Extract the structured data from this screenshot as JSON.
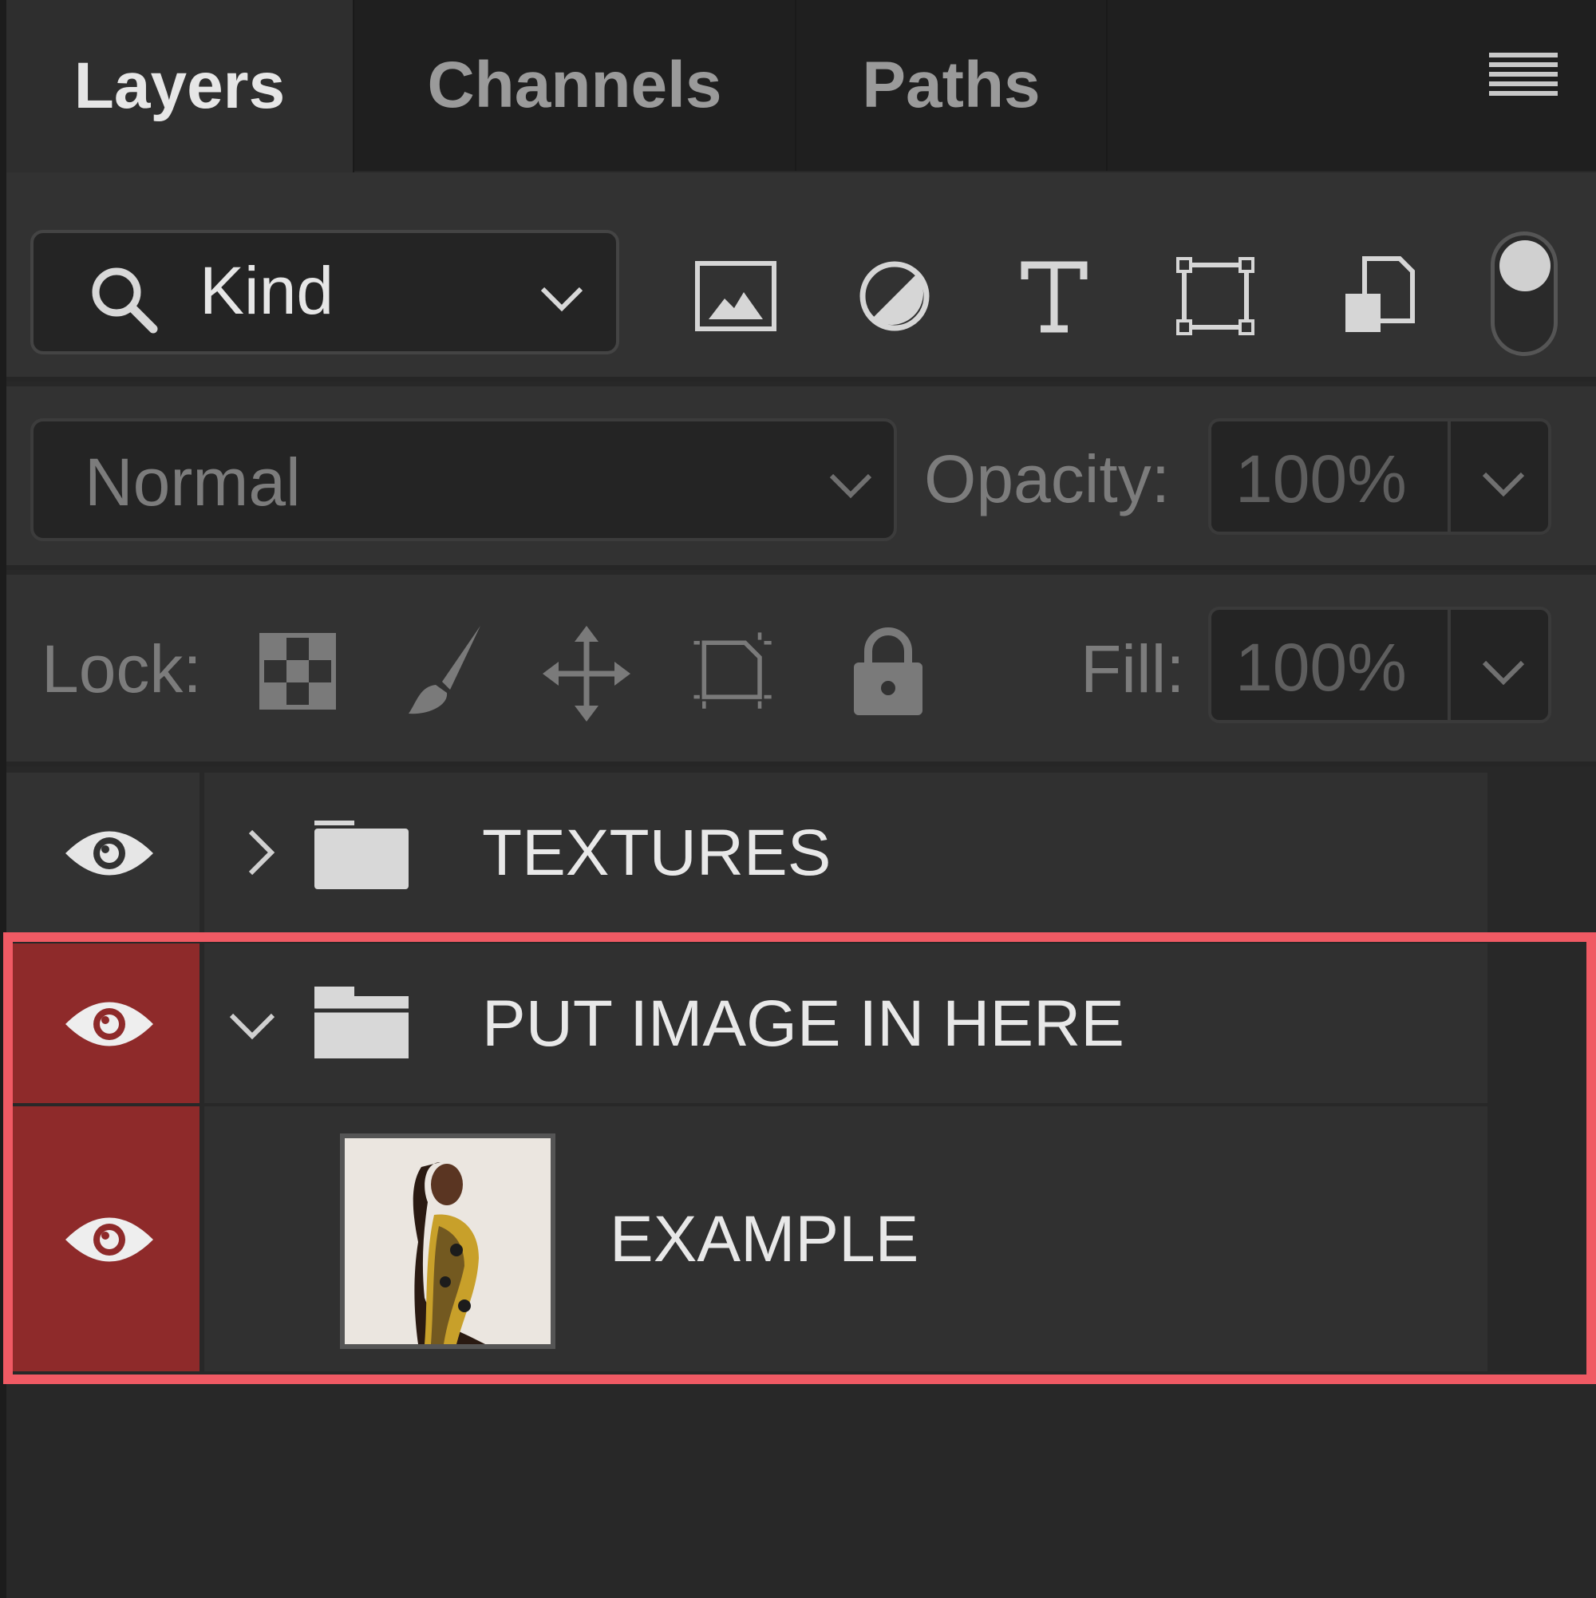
{
  "tabs": [
    {
      "label": "Layers",
      "active": true
    },
    {
      "label": "Channels",
      "active": false
    },
    {
      "label": "Paths",
      "active": false
    }
  ],
  "filter": {
    "kind_label": "Kind",
    "icons": [
      "image-filter-icon",
      "adjustment-filter-icon",
      "type-filter-icon",
      "shape-filter-icon",
      "smart-object-filter-icon"
    ],
    "toggle_on": true
  },
  "blend": {
    "mode": "Normal",
    "opacity_label": "Opacity:",
    "opacity_value": "100%"
  },
  "lock": {
    "label": "Lock:",
    "icons": [
      "lock-transparent-pixels-icon",
      "lock-image-pixels-icon",
      "lock-position-icon",
      "lock-artboard-icon",
      "lock-all-icon"
    ],
    "fill_label": "Fill:",
    "fill_value": "100%"
  },
  "layers": [
    {
      "name": "TEXTURES",
      "type": "group",
      "expanded": false,
      "visible": true,
      "highlighted": false
    },
    {
      "name": "PUT IMAGE IN HERE",
      "type": "group",
      "expanded": true,
      "visible": true,
      "highlighted": true
    },
    {
      "name": "EXAMPLE",
      "type": "image",
      "visible": true,
      "highlighted": true
    }
  ],
  "colors": {
    "highlight_border": "#f05a64",
    "eye_highlight_bg": "#8e2a2a",
    "panel_bg": "#323232"
  }
}
